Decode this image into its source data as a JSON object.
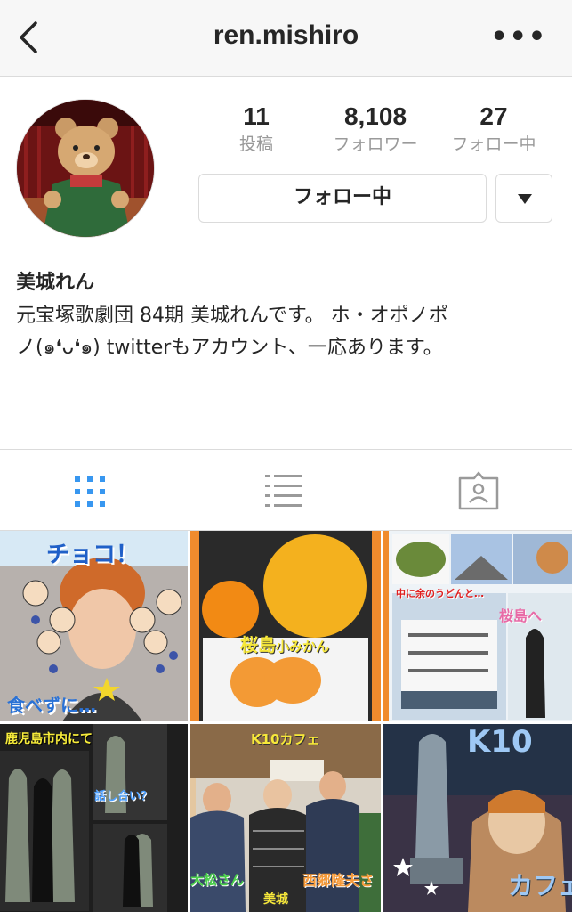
{
  "header": {
    "username": "ren.mishiro",
    "more": "•••"
  },
  "stats": [
    {
      "value": "11",
      "label": "投稿"
    },
    {
      "value": "8,108",
      "label": "フォロワー"
    },
    {
      "value": "27",
      "label": "フォロー中"
    }
  ],
  "follow_button": "フォロー中",
  "profile": {
    "name": "美城れん",
    "bio_line1": "元宝塚歌劇団 84期 美城れんです。 ホ・オポノポ",
    "bio_line2": "ノ(๑❛ᴗ❛๑) twitterもアカウント、一応あります。"
  },
  "tabs": [
    "grid-icon",
    "list-icon",
    "tagged-icon"
  ],
  "colors": {
    "accent": "#3897f0",
    "border": "#dbdbdb",
    "muted": "#9a9a9a"
  },
  "posts": [
    {
      "texts": [
        "チョコ！",
        "食べずに…"
      ]
    },
    {
      "texts": [
        "桜島",
        "小みかん"
      ]
    },
    {
      "texts": [
        "中に余のうどんと…",
        "桜島へ"
      ]
    },
    {
      "texts": [
        "鹿児島市内にて",
        "話し合い？"
      ]
    },
    {
      "texts": [
        "K10カフェ",
        "西郷隆夫さ",
        "大松さん",
        "美城"
      ]
    },
    {
      "texts": [
        "K10",
        "カフェ"
      ]
    }
  ]
}
